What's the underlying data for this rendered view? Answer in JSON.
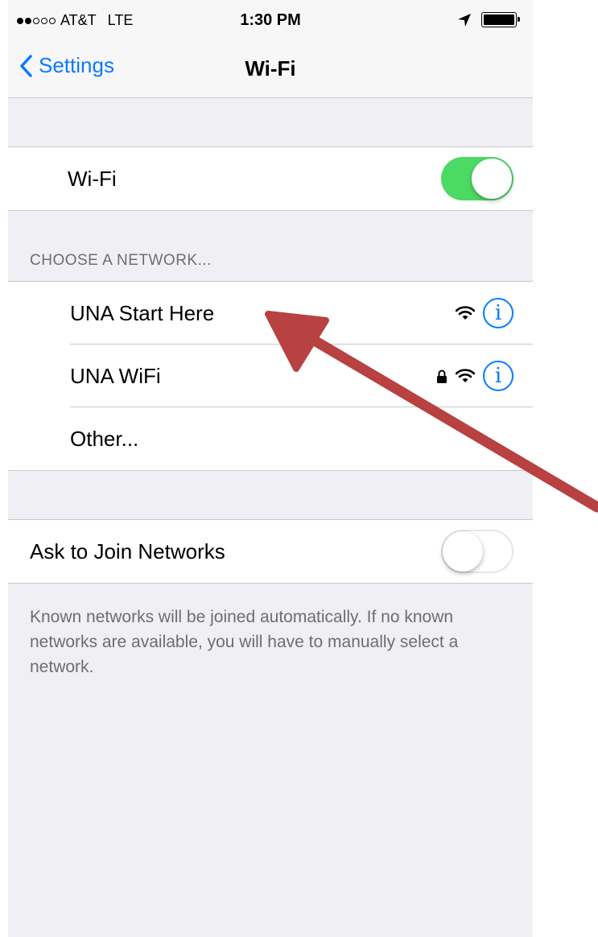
{
  "status_bar": {
    "signal_dots_filled": 2,
    "signal_dots_total": 5,
    "carrier": "AT&T",
    "network_type": "LTE",
    "time": "1:30 PM"
  },
  "nav": {
    "back_label": "Settings",
    "title": "Wi-Fi"
  },
  "wifi_toggle": {
    "label": "Wi-Fi",
    "on": true
  },
  "networks": {
    "header": "CHOOSE A NETWORK...",
    "items": [
      {
        "name": "UNA Start Here",
        "secured": false
      },
      {
        "name": "UNA WiFi",
        "secured": true
      }
    ],
    "other_label": "Other..."
  },
  "ask_to_join": {
    "label": "Ask to Join Networks",
    "on": false
  },
  "footer": "Known networks will be joined automatically. If no known networks are available, you will have to manually select a network.",
  "colors": {
    "accent": "#0a7aff",
    "toggle_on": "#4cd964",
    "annotation_arrow": "#b84141"
  }
}
